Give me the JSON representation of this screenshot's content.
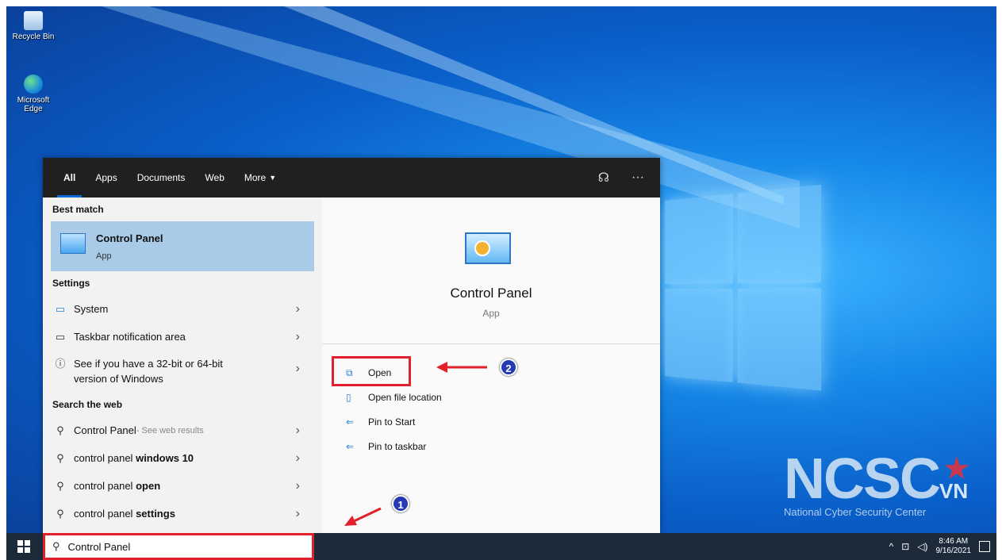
{
  "desktop": {
    "icons": [
      {
        "label": "Recycle Bin"
      },
      {
        "label": "Microsoft Edge"
      }
    ]
  },
  "search_tabs": [
    "All",
    "Apps",
    "Documents",
    "Web",
    "More"
  ],
  "results": {
    "best_match_heading": "Best match",
    "best_match": {
      "title": "Control Panel",
      "type": "App"
    },
    "settings_heading": "Settings",
    "settings": [
      {
        "label": "System",
        "icon": "monitor-icon"
      },
      {
        "label": "Taskbar notification area",
        "icon": "taskbar-icon"
      },
      {
        "label": "See if you have a 32-bit or 64-bit",
        "label2": "version of Windows",
        "icon": "info-icon"
      }
    ],
    "web_heading": "Search the web",
    "web": [
      {
        "prefix": "Control Panel",
        "suffix": " - See web results"
      },
      {
        "prefix": "control panel ",
        "bold": "windows 10"
      },
      {
        "prefix": "control panel ",
        "bold": "open"
      },
      {
        "prefix": "control panel ",
        "bold": "settings"
      }
    ]
  },
  "detail": {
    "title": "Control Panel",
    "type": "App",
    "actions": [
      "Open",
      "Open file location",
      "Pin to Start",
      "Pin to taskbar"
    ]
  },
  "annotations": {
    "step1": "1",
    "step2": "2",
    "highlight_color": "#e0202a",
    "badge_color": "#2439b3"
  },
  "taskbar": {
    "search_value": "Control Panel",
    "time": "8:46 AM",
    "date": "9/16/2021"
  },
  "watermark": {
    "logo": "NCSC",
    "suffix": "VN",
    "tagline": "National Cyber Security Center"
  },
  "colors": {
    "accent": "#0a6cd8",
    "selected": "#a9cbe8"
  }
}
